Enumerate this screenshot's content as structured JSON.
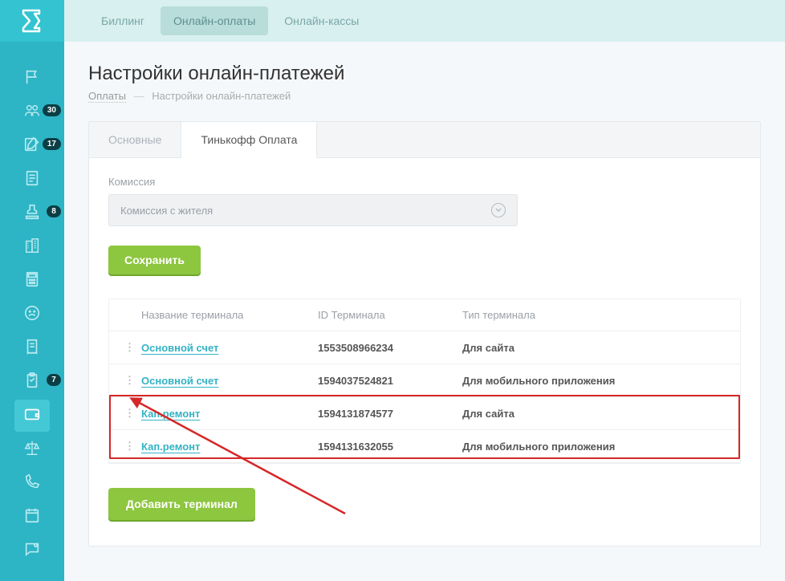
{
  "sidebar": {
    "badges": {
      "item1": "30",
      "item2": "17",
      "item4": "8",
      "item9": "7"
    }
  },
  "topnav": {
    "items": [
      "Биллинг",
      "Онлайн-оплаты",
      "Онлайн-кассы"
    ],
    "active": 1
  },
  "page": {
    "title": "Настройки онлайн-платежей",
    "breadcrumb_link": "Оплаты",
    "breadcrumb_current": "Настройки онлайн-платежей"
  },
  "tabs": {
    "items": [
      "Основные",
      "Тинькофф Оплата"
    ],
    "active": 1
  },
  "form": {
    "commission_label": "Комиссия",
    "commission_value": "Комиссия с жителя",
    "save_label": "Сохранить"
  },
  "table": {
    "headers": {
      "name": "Название терминала",
      "id": "ID Терминала",
      "type": "Тип терминала"
    },
    "rows": [
      {
        "name": "Основной счет",
        "id": "1553508966234",
        "type": "Для сайта"
      },
      {
        "name": "Основной счет",
        "id": "1594037524821",
        "type": "Для мобильного приложения"
      },
      {
        "name": "Кап.ремонт",
        "id": "1594131874577",
        "type": "Для сайта"
      },
      {
        "name": "Кап.ремонт",
        "id": "1594131632055",
        "type": "Для мобильного приложения"
      }
    ]
  },
  "buttons": {
    "add_terminal": "Добавить терминал"
  }
}
